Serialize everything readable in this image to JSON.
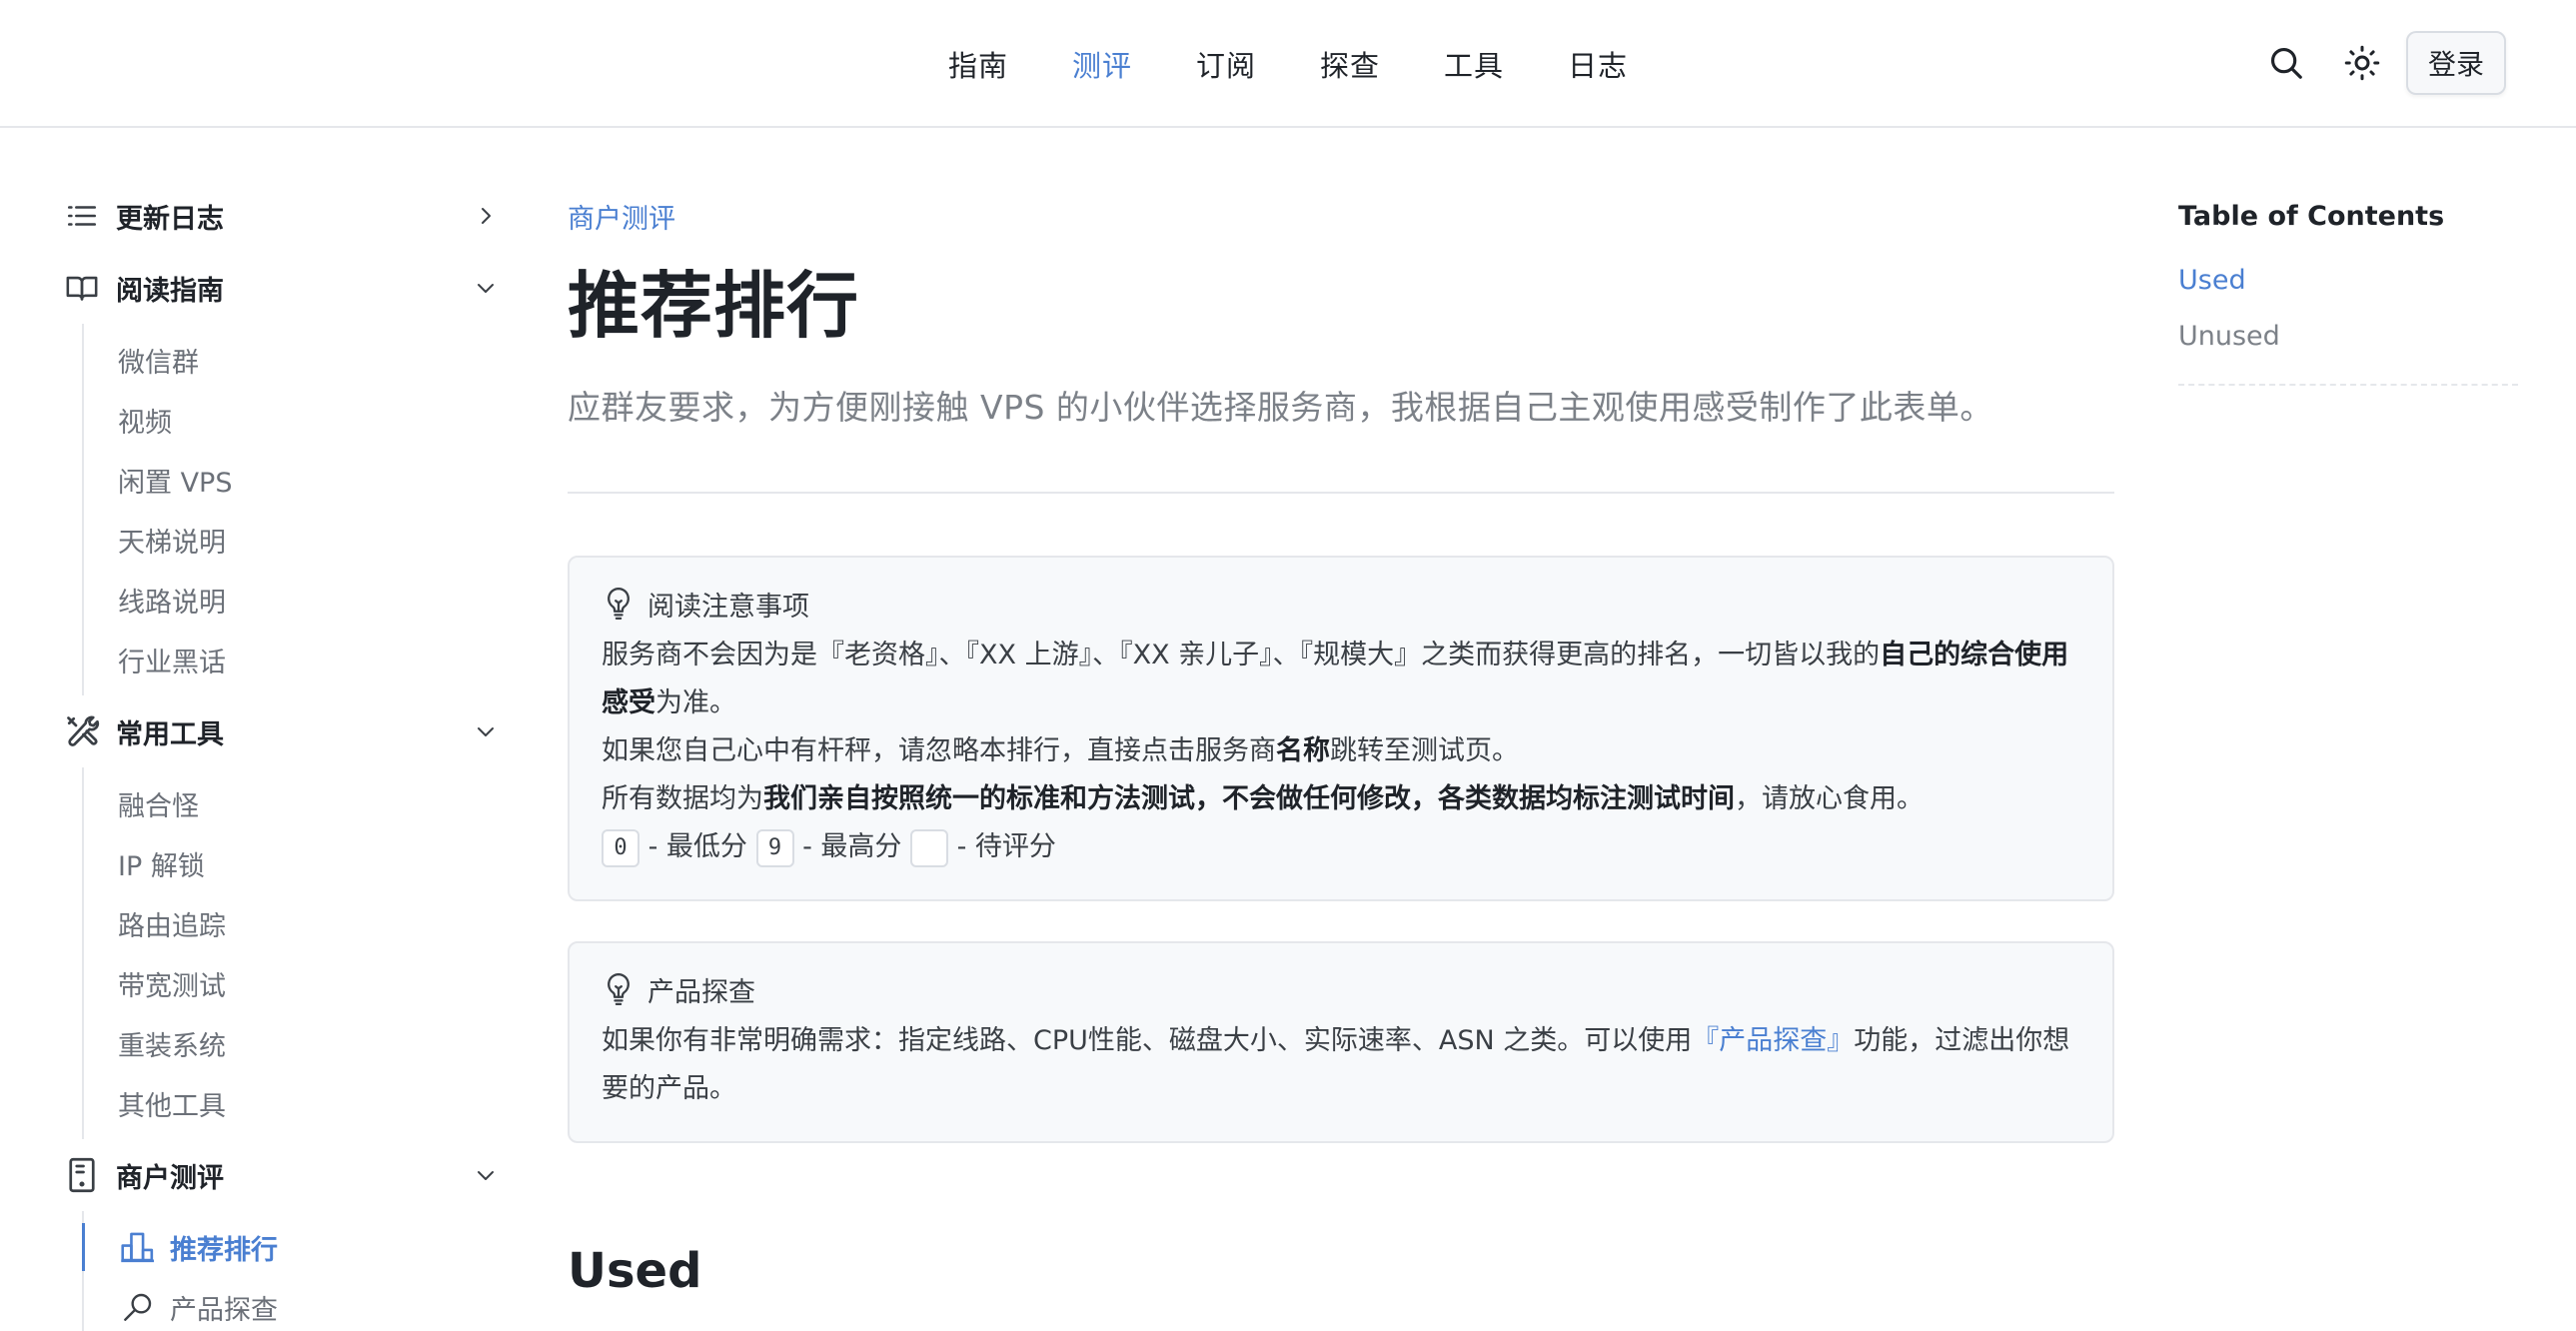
{
  "nav": {
    "items": [
      {
        "label": "指南",
        "active": false
      },
      {
        "label": "测评",
        "active": true
      },
      {
        "label": "订阅",
        "active": false
      },
      {
        "label": "探查",
        "active": false
      },
      {
        "label": "工具",
        "active": false
      },
      {
        "label": "日志",
        "active": false
      }
    ],
    "search_icon": "search-icon",
    "theme_icon": "sun-icon",
    "login_label": "登录"
  },
  "colors": {
    "accent": "#4a7fd1",
    "text": "#1f2329",
    "muted": "#7c8188",
    "border": "#e5e7eb",
    "callout_bg": "#f7f9fb"
  },
  "sidebar": {
    "sections": [
      {
        "label": "更新日志",
        "icon": "list-icon",
        "expanded": false,
        "items": []
      },
      {
        "label": "阅读指南",
        "icon": "book-icon",
        "expanded": true,
        "items": [
          "微信群",
          "视频",
          "闲置 VPS",
          "天梯说明",
          "线路说明",
          "行业黑话"
        ]
      },
      {
        "label": "常用工具",
        "icon": "tools-icon",
        "expanded": true,
        "items": [
          "融合怪",
          "IP 解锁",
          "路由追踪",
          "带宽测试",
          "重装系统",
          "其他工具"
        ]
      },
      {
        "label": "商户测评",
        "icon": "server-icon",
        "expanded": true,
        "items": [
          {
            "label": "推荐排行",
            "icon": "ranking-icon",
            "active": true
          },
          {
            "label": "产品探查",
            "icon": "magnifier-icon",
            "active": false
          }
        ]
      }
    ]
  },
  "main": {
    "breadcrumb": "商户测评",
    "title": "推荐排行",
    "lead": "应群友要求，为方便刚接触 VPS 的小伙伴选择服务商，我根据自己主观使用感受制作了此表单。",
    "callout1": {
      "title": "阅读注意事项",
      "p1_a": "服务商不会因为是『老资格』、『XX 上游』、『XX 亲儿子』、『规模大』之类而获得更高的排名，一切皆以我的",
      "p1_b": "自己的综合使用感受",
      "p1_c": "为准。",
      "p2_a": "如果您自己心中有杆秤，请忽略本排行，直接点击服务商",
      "p2_b": "名称",
      "p2_c": "跳转至测试页。",
      "p3_a": "所有数据均为",
      "p3_b": "我们亲自按照统一的标准和方法测试，不会做任何修改，各类数据均标注测试时间",
      "p3_c": "，请放心食用。",
      "score_min_key": "0",
      "score_min_label": " - 最低分 ",
      "score_max_key": "9",
      "score_max_label": " - 最高分 ",
      "score_pending_key": "",
      "score_pending_label": " - 待评分"
    },
    "callout2": {
      "title": "产品探查",
      "p1_a": "如果你有非常明确需求：指定线路、CPU性能、磁盘大小、实际速率、ASN 之类。可以使用",
      "p1_link": "『产品探查』",
      "p1_c": "功能，过滤出你想要的产品。"
    },
    "section_heading": "Used"
  },
  "toc": {
    "title": "Table of Contents",
    "items": [
      {
        "label": "Used",
        "active": true
      },
      {
        "label": "Unused",
        "active": false
      }
    ]
  }
}
